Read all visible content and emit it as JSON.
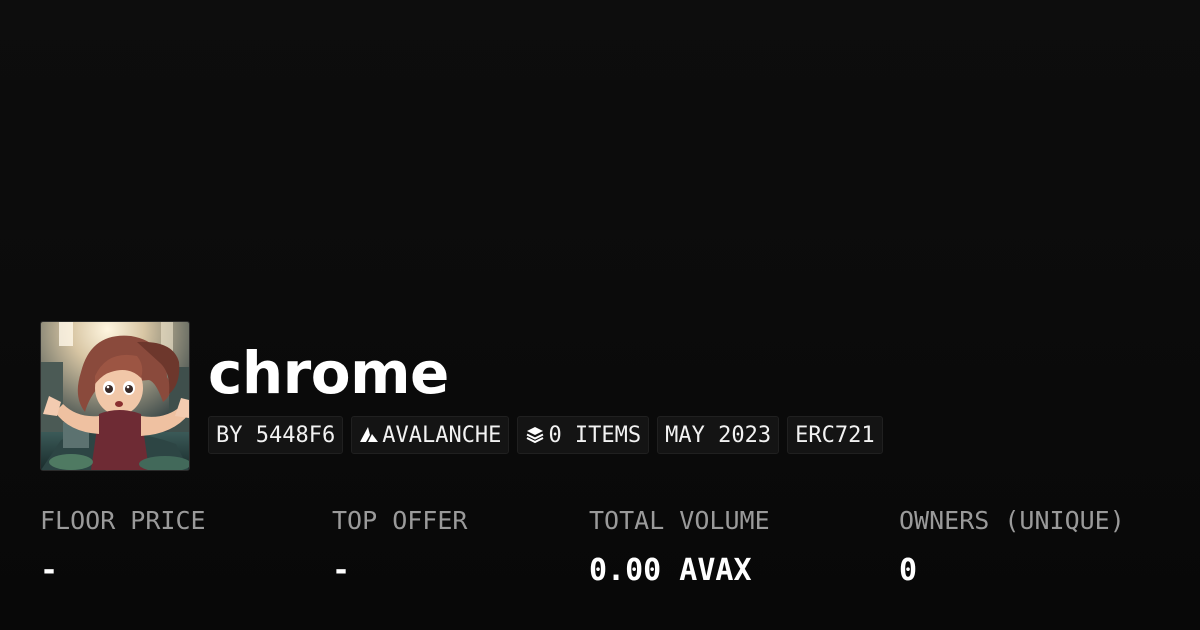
{
  "collection": {
    "name": "chrome",
    "creator_label": "BY 5448F6",
    "chain_label": "AVALANCHE",
    "items_label": "0 ITEMS",
    "date_label": "MAY 2023",
    "standard_label": "ERC721",
    "chain_icon": "avalanche-logo-icon",
    "items_icon": "layers-icon",
    "avatar_image": "anime-character-reaching-out"
  },
  "stats": [
    {
      "label": "FLOOR PRICE",
      "value": "-"
    },
    {
      "label": "TOP OFFER",
      "value": "-"
    },
    {
      "label": "TOTAL VOLUME",
      "value": "0.00 AVAX"
    },
    {
      "label": "OWNERS (UNIQUE)",
      "value": "0"
    }
  ],
  "colors": {
    "background": "#0a0a0a",
    "pill_background": "#141414",
    "pill_border": "#202020",
    "label_gray": "#9a9a9a",
    "text_white": "#ffffff"
  }
}
